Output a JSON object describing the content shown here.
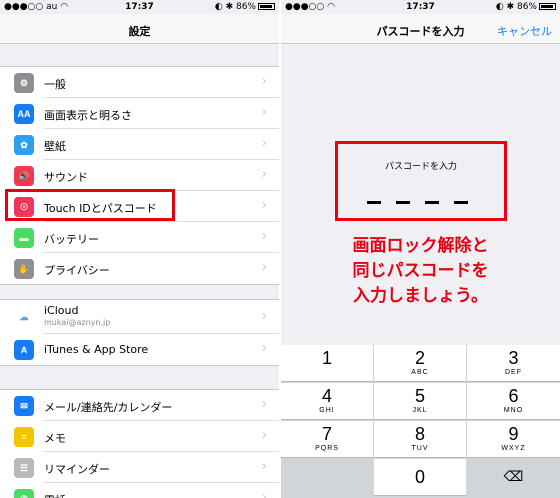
{
  "left": {
    "status": {
      "carrier": "au",
      "time": "17:37",
      "battery": "86%"
    },
    "title": "設定",
    "groups": [
      [
        {
          "label": "一般",
          "icon_text": "⚙",
          "icon_color": "#8e8e93"
        },
        {
          "label": "画面表示と明るさ",
          "icon_text": "AA",
          "icon_color": "#1a7cf5"
        },
        {
          "label": "壁紙",
          "icon_text": "✿",
          "icon_color": "#2c9ff0"
        },
        {
          "label": "サウンド",
          "icon_text": "🔊",
          "icon_color": "#f03a4b"
        },
        {
          "label": "Touch IDとパスコード",
          "icon_text": "☉",
          "icon_color": "#f0365a"
        },
        {
          "label": "バッテリー",
          "icon_text": "▬",
          "icon_color": "#4cd964"
        },
        {
          "label": "プライバシー",
          "icon_text": "✋",
          "icon_color": "#8e8e93"
        }
      ],
      [
        {
          "label": "iCloud",
          "sub": "mukai@aznyn.jp",
          "icon_text": "☁",
          "icon_color": "#4aa3f0"
        },
        {
          "label": "iTunes & App Store",
          "icon_text": "A",
          "icon_color": "#1a7cf5"
        }
      ],
      [
        {
          "label": "メール/連絡先/カレンダー",
          "icon_text": "✉",
          "icon_color": "#1a7cf5"
        },
        {
          "label": "メモ",
          "icon_text": "≡",
          "icon_color": "#f5c400"
        },
        {
          "label": "リマインダー",
          "icon_text": "☰",
          "icon_color": "#b8b8bd"
        },
        {
          "label": "電話",
          "icon_text": "✆",
          "icon_color": "#4cd964"
        }
      ]
    ]
  },
  "right": {
    "status": {
      "time": "17:37",
      "battery": "86%"
    },
    "title": "パスコードを入力",
    "cancel": "キャンセル",
    "pin_title": "パスコードを入力",
    "note_lines": [
      "画面ロック解除と",
      "同じパスコードを",
      "入力しましょう。"
    ],
    "keys": [
      {
        "num": "1",
        "letters": ""
      },
      {
        "num": "2",
        "letters": "ABC"
      },
      {
        "num": "3",
        "letters": "DEF"
      },
      {
        "num": "4",
        "letters": "GHI"
      },
      {
        "num": "5",
        "letters": "JKL"
      },
      {
        "num": "6",
        "letters": "MNO"
      },
      {
        "num": "7",
        "letters": "PQRS"
      },
      {
        "num": "8",
        "letters": "TUV"
      },
      {
        "num": "9",
        "letters": "WXYZ"
      },
      {
        "num": "0",
        "letters": ""
      }
    ]
  }
}
